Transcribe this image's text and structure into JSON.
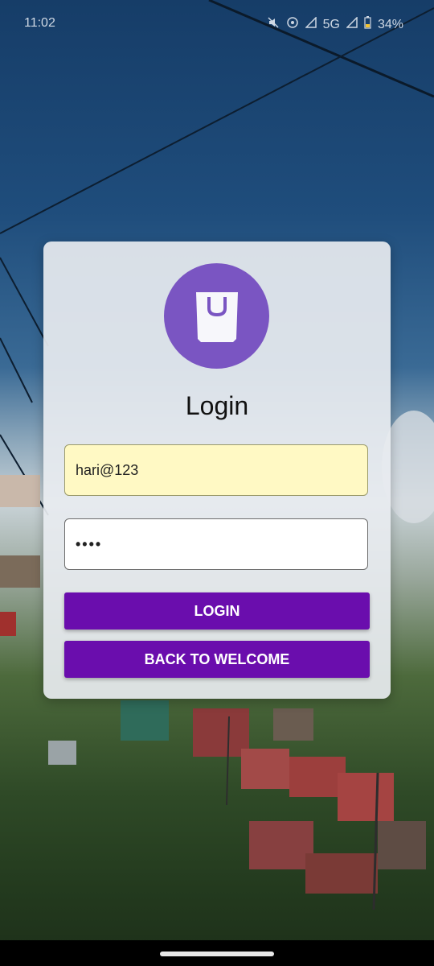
{
  "status_bar": {
    "time": "11:02",
    "network": "5G",
    "battery": "34%"
  },
  "login_card": {
    "title": "Login",
    "email_value": "hari@123",
    "password_value": "••••",
    "login_label": "LOGIN",
    "back_label": "BACK TO WELCOME"
  },
  "colors": {
    "accent": "#6a0dad",
    "logo_bg": "#7a55c2",
    "email_bg": "#fff9c4"
  },
  "icons": {
    "logo": "shopping-bag-icon"
  }
}
